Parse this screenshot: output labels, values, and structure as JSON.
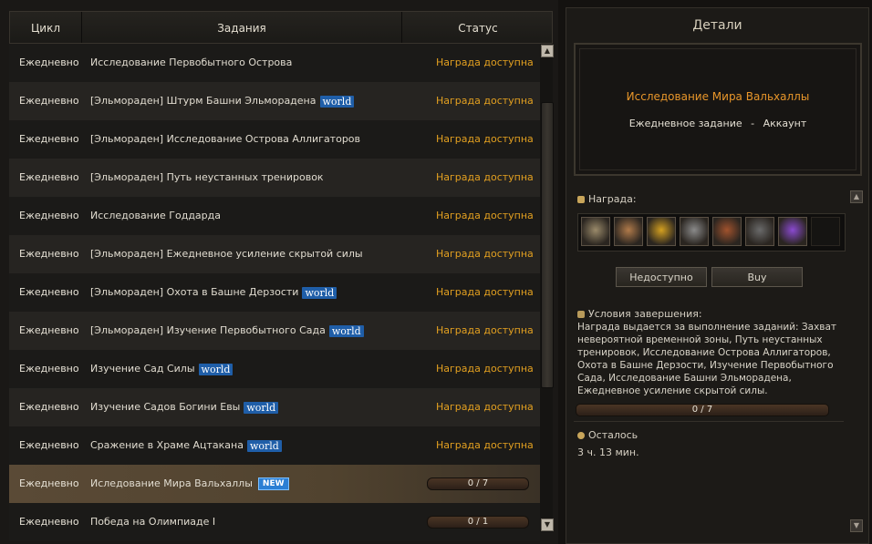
{
  "table": {
    "headers": {
      "cycle": "Цикл",
      "tasks": "Задания",
      "status": "Статус"
    },
    "rows": [
      {
        "cycle": "Ежедневно",
        "task": "Исследование Первобытного Острова",
        "tag": "",
        "status": "Награда доступна"
      },
      {
        "cycle": "Ежедневно",
        "task": "[Эльмораден] Штурм Башни Эльморадена",
        "tag": "world",
        "status": "Награда доступна"
      },
      {
        "cycle": "Ежедневно",
        "task": "[Эльмораден] Исследование Острова Аллигаторов",
        "tag": "",
        "status": "Награда доступна"
      },
      {
        "cycle": "Ежедневно",
        "task": "[Эльмораден] Путь неустанных тренировок",
        "tag": "",
        "status": "Награда доступна"
      },
      {
        "cycle": "Ежедневно",
        "task": "Исследование Годдарда",
        "tag": "",
        "status": "Награда доступна"
      },
      {
        "cycle": "Ежедневно",
        "task": "[Эльмораден] Ежедневное усиление скрытой силы",
        "tag": "",
        "status": "Награда доступна"
      },
      {
        "cycle": "Ежедневно",
        "task": "[Эльмораден] Охота в Башне Дерзости",
        "tag": "world",
        "status": "Награда доступна"
      },
      {
        "cycle": "Ежедневно",
        "task": "[Эльмораден] Изучение Первобытного Сада",
        "tag": "world",
        "status": "Награда доступна"
      },
      {
        "cycle": "Ежедневно",
        "task": "Изучение Сад Силы",
        "tag": "world",
        "status": "Награда доступна"
      },
      {
        "cycle": "Ежедневно",
        "task": "Изучение Садов Богини Евы",
        "tag": "world",
        "status": "Награда доступна"
      },
      {
        "cycle": "Ежедневно",
        "task": "Сражение в Храме Ацтакана",
        "tag": "world",
        "status": "Награда доступна"
      },
      {
        "cycle": "Ежедневно",
        "task": "Иследование Мира Вальхаллы",
        "tag": "NEW",
        "progress": "0 / 7",
        "progress_fraction": 0,
        "selected": true
      },
      {
        "cycle": "Ежедневно",
        "task": "Победа на Олимпиаде I",
        "tag": "",
        "progress": "0 / 1",
        "progress_fraction": 0
      }
    ]
  },
  "details": {
    "title": "Детали",
    "quest_name": "Исследование Мира Вальхаллы",
    "quest_type": "Ежедневное задание",
    "quest_sep": "-",
    "quest_scope": "Аккаунт",
    "reward_label": "Награда:",
    "rewards": [
      {
        "icon": "scroll-document-icon",
        "color": "#9a8a6a"
      },
      {
        "icon": "bronze-medallion-icon",
        "color": "#b07a4a"
      },
      {
        "icon": "gold-coin-l-icon",
        "color": "#d4a020"
      },
      {
        "icon": "statue-figure-icon",
        "color": "#8a8a8a"
      },
      {
        "icon": "treasure-map-icon",
        "color": "#a0522d"
      },
      {
        "icon": "ore-crystal-icon",
        "color": "#6a6a6a"
      },
      {
        "icon": "purple-cauldron-icon",
        "color": "#8a4ad0"
      }
    ],
    "btn_unavailable": "Недоступно",
    "btn_buy": "Buy",
    "conditions_label": "Условия завершения:",
    "conditions_text": "Награда выдается за выполнение заданий: Захват невероятной временной зоны, Путь неустанных тренировок, Исследование Острова Аллигаторов, Охота в Башне Дерзости, Изучение Первобытного Сада, Исследование Башни Эльморадена, Ежедневное усиление скрытой силы.",
    "conditions_progress": "0 / 7",
    "remaining_label": "Осталось",
    "remaining_value": "3 ч. 13 мин."
  }
}
